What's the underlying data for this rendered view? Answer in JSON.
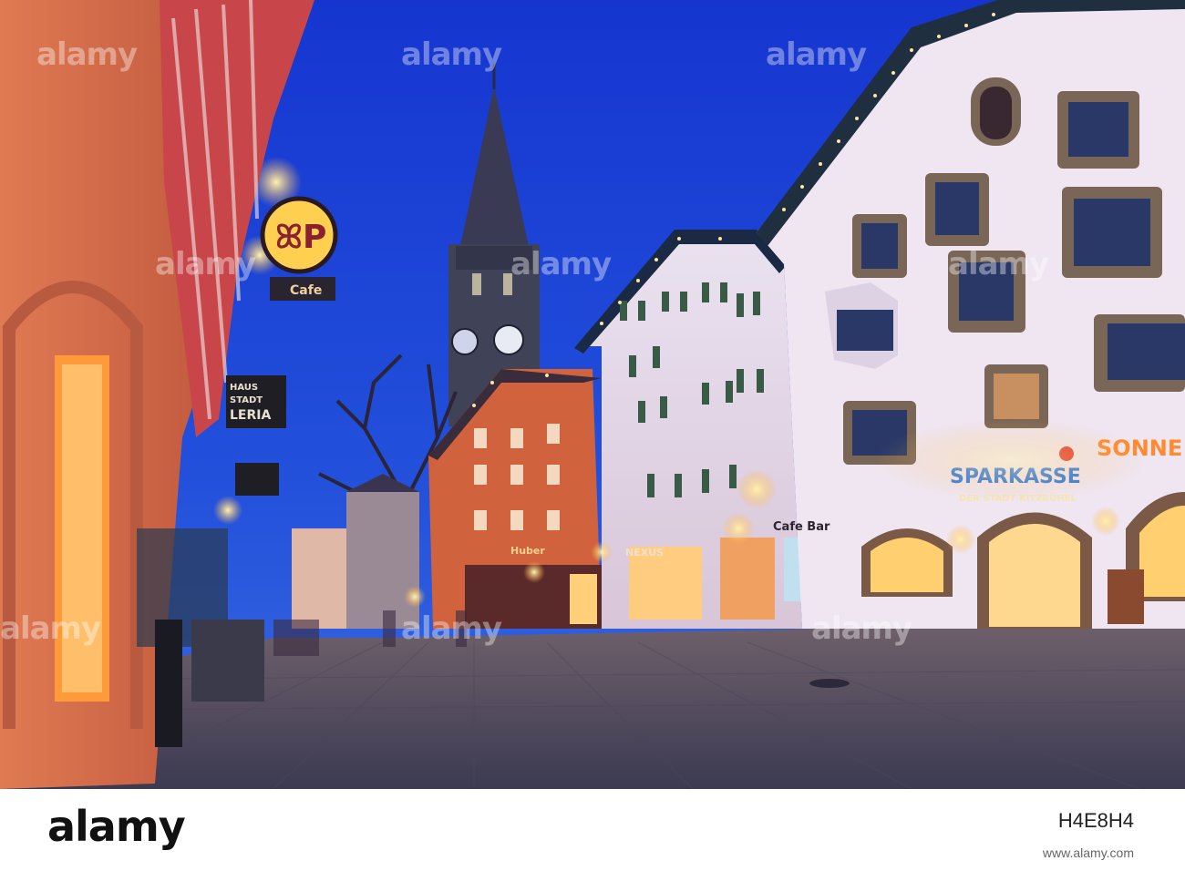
{
  "photo": {
    "description_free": true,
    "signs": {
      "cafe": "Cafe",
      "galerie_1": "HAUS",
      "galerie_2": "STADT",
      "galerie_3": "LERIA",
      "sparkasse": "SPARKASSE",
      "sparkasse_sub": "DER STADT KITZBÜHEL",
      "sonne": "SONNE",
      "cafe_bar": "Cafe Bar",
      "huber": "Huber",
      "nexus": "NEXUS"
    },
    "watermarks": [
      "alamy",
      "alamy",
      "alamy",
      "alamy",
      "alamy",
      "alamy",
      "alamy",
      "alamy",
      "alamy"
    ]
  },
  "footer": {
    "logo": "alamy",
    "image_id": "H4E8H4",
    "website": "www.alamy.com"
  },
  "colors": {
    "sky_top": "#1b3fd6",
    "sky_bottom": "#2a56d8",
    "street": "#5c5870",
    "lamp": "#ffb84a"
  }
}
